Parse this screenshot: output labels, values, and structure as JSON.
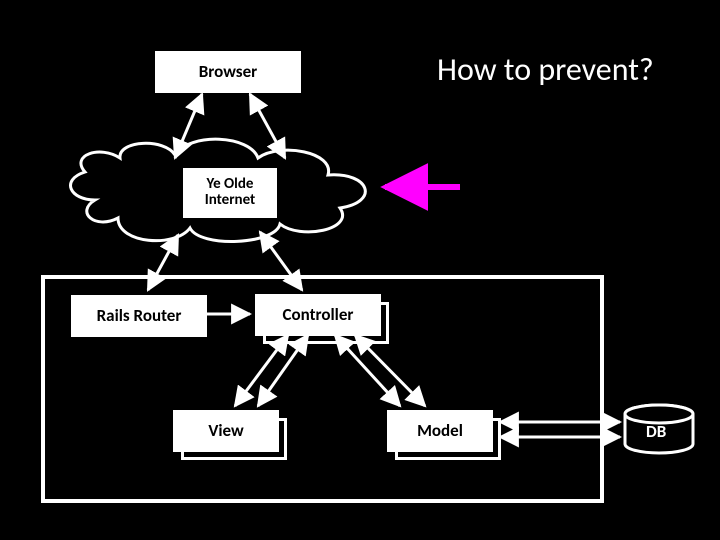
{
  "title": "How to prevent?",
  "nodes": {
    "browser": "Browser",
    "internet": "Ye Olde\nInternet",
    "router": "Rails Router",
    "controller": "Controller",
    "view": "View",
    "model": "Model",
    "db": "DB"
  },
  "accent_color": "#ff00ff"
}
